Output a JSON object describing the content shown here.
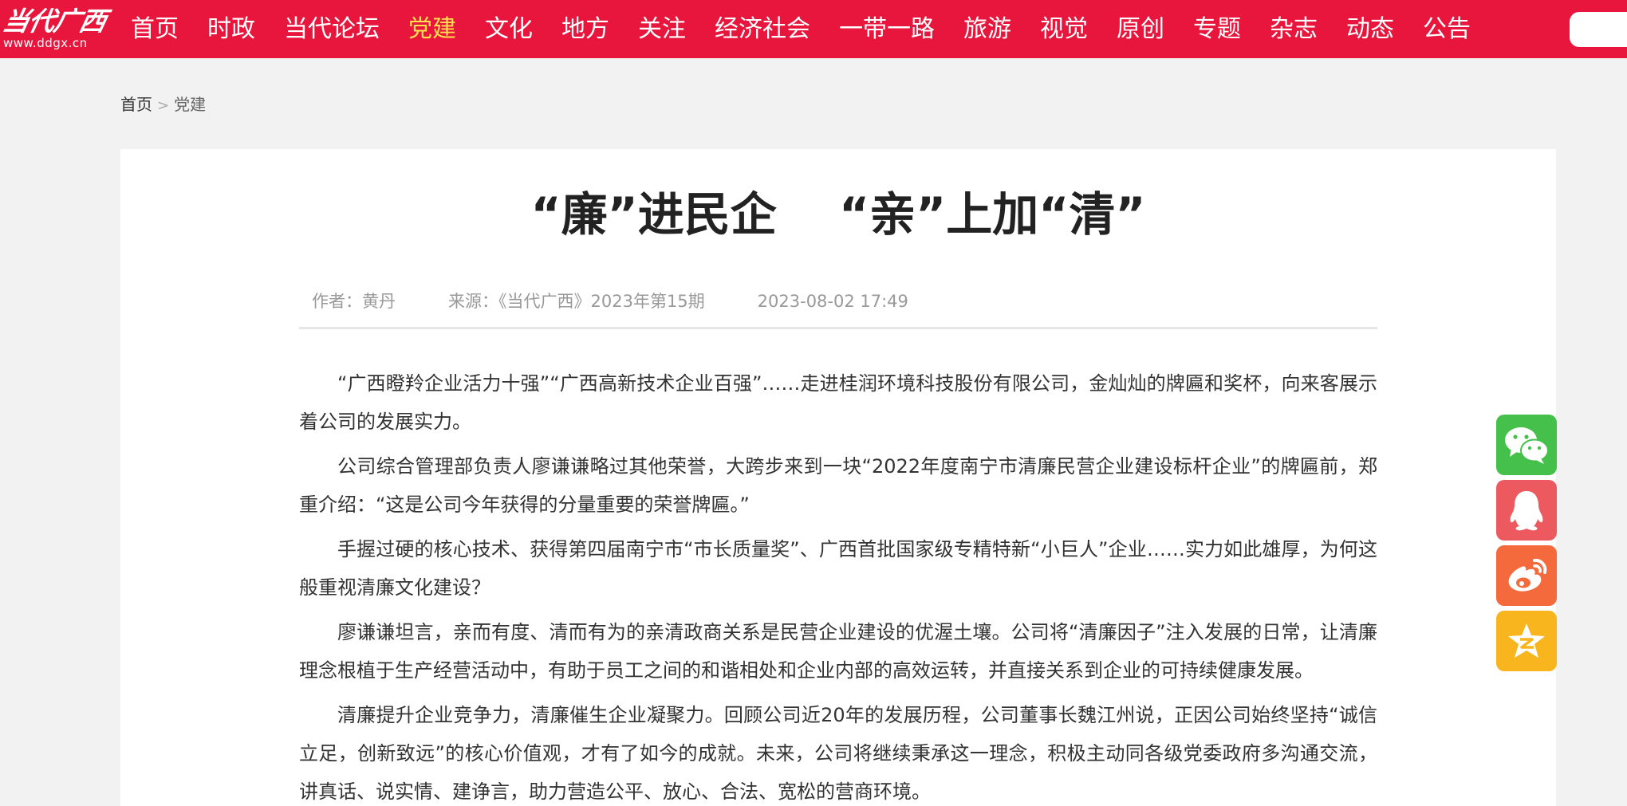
{
  "header": {
    "logo_script": "当代广西",
    "logo_url": "www.ddgx.cn",
    "nav": [
      {
        "label": "首页"
      },
      {
        "label": "时政"
      },
      {
        "label": "当代论坛"
      },
      {
        "label": "党建",
        "active": true
      },
      {
        "label": "文化"
      },
      {
        "label": "地方"
      },
      {
        "label": "关注"
      },
      {
        "label": "经济社会"
      },
      {
        "label": "一带一路"
      },
      {
        "label": "旅游"
      },
      {
        "label": "视觉"
      },
      {
        "label": "原创"
      },
      {
        "label": "专题"
      },
      {
        "label": "杂志"
      },
      {
        "label": "动态"
      },
      {
        "label": "公告"
      }
    ],
    "colors": {
      "bar": "#e8163c",
      "active": "#ffe14d"
    }
  },
  "breadcrumb": {
    "home": "首页",
    "separator": ">",
    "current": "党建"
  },
  "article": {
    "title": "“廉”进民企　 “亲”上加“清”",
    "author": "作者：黄丹",
    "source": "来源：《当代广西》2023年第15期",
    "datetime": "2023-08-02 17:49",
    "paragraphs": [
      "“广西瞪羚企业活力十强”“广西高新技术企业百强”……走进桂润环境科技股份有限公司，金灿灿的牌匾和奖杯，向来客展示着公司的发展实力。",
      "公司综合管理部负责人廖谦谦略过其他荣誉，大跨步来到一块“2022年度南宁市清廉民营企业建设标杆企业”的牌匾前，郑重介绍：“这是公司今年获得的分量重要的荣誉牌匾。”",
      "手握过硬的核心技术、获得第四届南宁市“市长质量奖”、广西首批国家级专精特新“小巨人”企业……实力如此雄厚，为何这般重视清廉文化建设？",
      "廖谦谦坦言，亲而有度、清而有为的亲清政商关系是民营企业建设的优渥土壤。公司将“清廉因子”注入发展的日常，让清廉理念根植于生产经营活动中，有助于员工之间的和谐相处和企业内部的高效运转，并直接关系到企业的可持续健康发展。",
      "清廉提升企业竞争力，清廉催生企业凝聚力。回顾公司近20年的发展历程，公司董事长魏江州说，正因公司始终坚持“诚信立足，创新致远”的核心价值观，才有了如今的成就。未来，公司将继续秉承这一理念，积极主动同各级党委政府多沟通交流，讲真话、说实情、建诤言，助力营造公平、放心、合法、宽松的营商环境。"
    ]
  },
  "share": [
    {
      "icon": "wechat-icon",
      "color": "#45c14b"
    },
    {
      "icon": "qq-icon",
      "color": "#ec5a5f"
    },
    {
      "icon": "weibo-icon",
      "color": "#f46a3c"
    },
    {
      "icon": "qzone-icon",
      "color": "#f8b51d"
    }
  ]
}
